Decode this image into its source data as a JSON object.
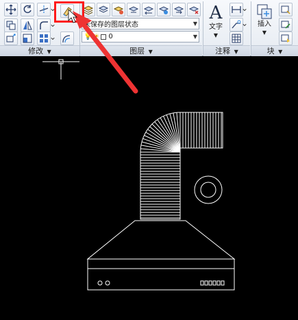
{
  "ribbon": {
    "modify_panel": {
      "title": "修改",
      "caret": "▼"
    },
    "layers_panel": {
      "title": "图层",
      "caret": "▼",
      "layer_state_value": "未保存的图层状态",
      "current_layer_value": "0"
    },
    "annotation_panel": {
      "title": "注释",
      "caret": "▼",
      "text_label": "文字",
      "text_big_glyph": "A"
    },
    "block_panel": {
      "title": "块",
      "caret": "▼",
      "insert_label": "插入"
    }
  },
  "colors": {
    "highlight": "#ff1a1a",
    "pointer_arrow": "#ee3333",
    "drawing_lines": "#ffffff",
    "canvas": "#000000"
  }
}
